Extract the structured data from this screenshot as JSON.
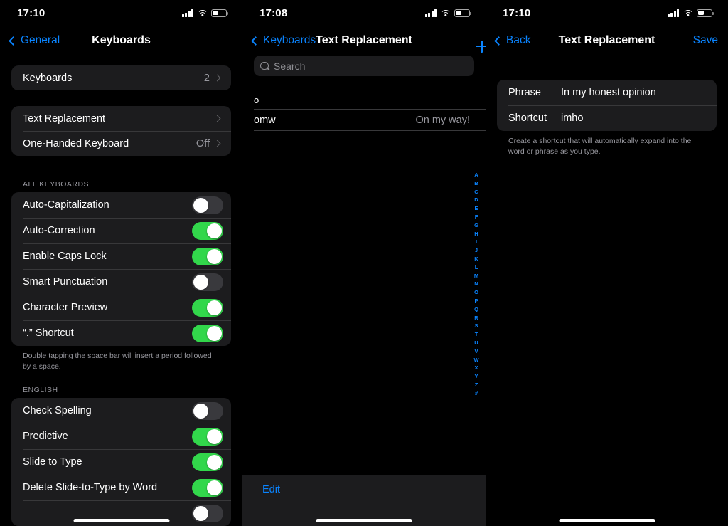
{
  "panels": {
    "keyboards": {
      "status": {
        "time": "17:10",
        "battery_pct": 42
      },
      "nav": {
        "back_label": "General",
        "title": "Keyboards"
      },
      "group1": [
        {
          "label": "Keyboards",
          "value": "2",
          "type": "disclosure"
        }
      ],
      "group2": [
        {
          "label": "Text Replacement",
          "value": "",
          "type": "disclosure"
        },
        {
          "label": "One-Handed Keyboard",
          "value": "Off",
          "type": "disclosure"
        }
      ],
      "all_keyboards_header": "ALL KEYBOARDS",
      "all_keyboards": [
        {
          "label": "Auto-Capitalization",
          "on": false
        },
        {
          "label": "Auto-Correction",
          "on": true
        },
        {
          "label": "Enable Caps Lock",
          "on": true
        },
        {
          "label": "Smart Punctuation",
          "on": false
        },
        {
          "label": "Character Preview",
          "on": true
        },
        {
          "label": "“.” Shortcut",
          "on": true
        }
      ],
      "all_keyboards_footer": "Double tapping the space bar will insert a period followed by a space.",
      "english_header": "ENGLISH",
      "english": [
        {
          "label": "Check Spelling",
          "on": false
        },
        {
          "label": "Predictive",
          "on": true
        },
        {
          "label": "Slide to Type",
          "on": true
        },
        {
          "label": "Delete Slide-to-Type by Word",
          "on": true
        },
        {
          "label": "",
          "on": false
        }
      ]
    },
    "text_replacement_list": {
      "status": {
        "time": "17:08",
        "battery_pct": 42
      },
      "nav": {
        "back_label": "Keyboards",
        "title": "Text Replacement",
        "add_label": "+"
      },
      "search": {
        "placeholder": "Search",
        "value": ""
      },
      "sections": [
        {
          "header": "o",
          "rows": [
            {
              "shortcut": "omw",
              "phrase": "On my way!"
            }
          ]
        }
      ],
      "index": [
        "A",
        "B",
        "C",
        "D",
        "E",
        "F",
        "G",
        "H",
        "I",
        "J",
        "K",
        "L",
        "M",
        "N",
        "O",
        "P",
        "Q",
        "R",
        "S",
        "T",
        "U",
        "V",
        "W",
        "X",
        "Y",
        "Z",
        "#"
      ],
      "toolbar": {
        "edit_label": "Edit"
      }
    },
    "text_replacement_edit": {
      "status": {
        "time": "17:10",
        "battery_pct": 42
      },
      "nav": {
        "back_label": "Back",
        "title": "Text Replacement",
        "save_label": "Save"
      },
      "fields": [
        {
          "label": "Phrase",
          "value": "In my honest opinion"
        },
        {
          "label": "Shortcut",
          "value": "imho"
        }
      ],
      "footer": "Create a shortcut that will automatically expand into the word or phrase as you type."
    }
  },
  "colors": {
    "accent": "#0a84ff",
    "switch_on": "#32d74b",
    "switch_off": "#39393d",
    "card": "#1c1c1e",
    "background": "#000000",
    "secondary_text": "#98989f"
  }
}
